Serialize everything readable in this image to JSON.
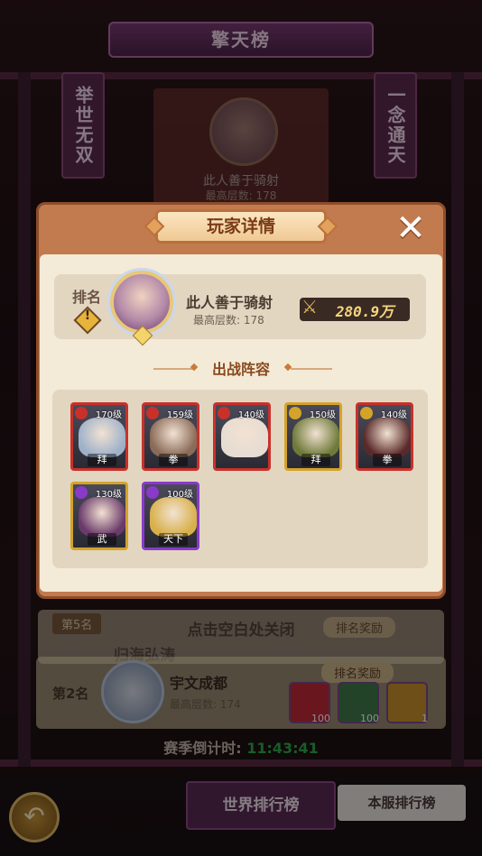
{
  "header": {
    "title": "擎天榜"
  },
  "banners": {
    "left": "举世无双",
    "right": "一念通天"
  },
  "background_top": {
    "name": "此人善于骑射",
    "floor": "最高层数: 178"
  },
  "modal": {
    "title": "玩家详情",
    "close_glyph": "✕",
    "rank_label": "排名",
    "rank_badge": "!",
    "player": {
      "name": "此人善于骑射",
      "floor": "最高层数: 178",
      "power": "280.9万"
    },
    "lineup_title": "出战阵容",
    "heroes": [
      {
        "level": "170级",
        "tag": "拜",
        "frame": "#c8312a",
        "face": "#9fb1c9",
        "badge": "#c8312a"
      },
      {
        "level": "159级",
        "tag": "拳",
        "frame": "#c8312a",
        "face": "#8a6a58",
        "badge": "#c8312a"
      },
      {
        "level": "140级",
        "tag": "",
        "frame": "#c8312a",
        "face": "#e6dcd2",
        "badge": "#c8312a"
      },
      {
        "level": "150级",
        "tag": "拜",
        "frame": "#d4a32a",
        "face": "#6f7a3a",
        "badge": "#d4a32a"
      },
      {
        "level": "140级",
        "tag": "拳",
        "frame": "#c8312a",
        "face": "#5a2a2a",
        "badge": "#d4a32a"
      },
      {
        "level": "130级",
        "tag": "武",
        "frame": "#d4a32a",
        "face": "#6a3a6a",
        "badge": "#8a3ac8"
      },
      {
        "level": "100级",
        "tag": "天下",
        "frame": "#8a3ac8",
        "face": "#d8b04a",
        "badge": "#8a3ac8"
      }
    ]
  },
  "close_hint": "点击空白处关闭",
  "list": {
    "row5": {
      "rank": "第5名",
      "name": "归海弘涛",
      "reward_label": "排名奖励"
    },
    "row2": {
      "rank": "第2名",
      "name": "宇文成都",
      "floor": "最高层数: 174",
      "reward_label": "排名奖励",
      "items": [
        {
          "count": "100",
          "color": "#c0283a"
        },
        {
          "count": "100",
          "color": "#3f7a4a"
        },
        {
          "count": "1",
          "color": "#c8902a"
        }
      ]
    }
  },
  "countdown": {
    "label": "赛季倒计时:",
    "value": "11:43:41"
  },
  "tabs": {
    "world": "世界排行榜",
    "server": "本服排行榜"
  },
  "back_glyph": "↶"
}
